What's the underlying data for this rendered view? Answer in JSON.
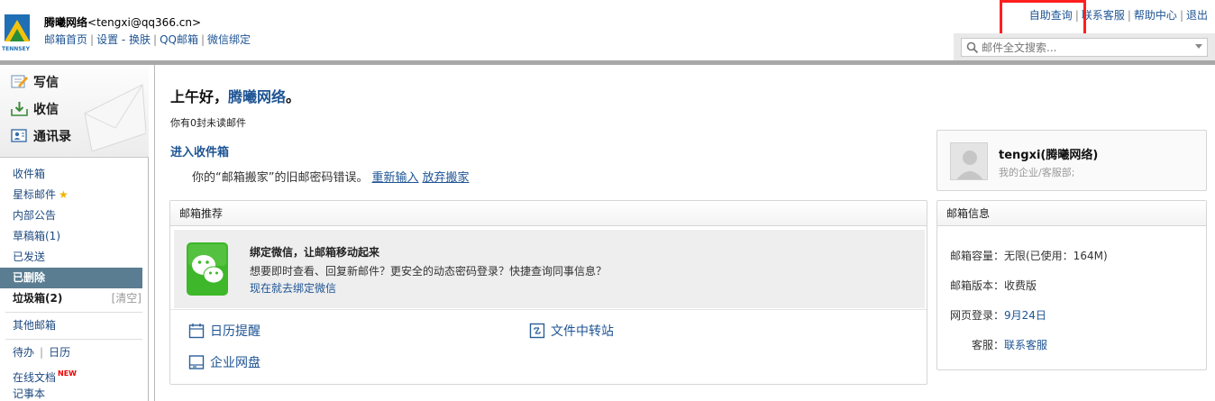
{
  "header": {
    "user_name": "腾曦网络",
    "user_email": "<tengxi@qq366.cn>",
    "nav": [
      "邮箱首页",
      "设置 - 换肤",
      "QQ邮箱",
      "微信绑定"
    ],
    "top_links": [
      "自助查询",
      "联系客服",
      "帮助中心",
      "退出"
    ],
    "search_placeholder": "邮件全文搜索..."
  },
  "sidebar": {
    "compose": "写信",
    "receive": "收信",
    "contacts": "通讯录",
    "folders": [
      {
        "label": "收件箱"
      },
      {
        "label": "星标邮件"
      },
      {
        "label": "内部公告"
      },
      {
        "label": "草稿箱(1)"
      },
      {
        "label": "已发送"
      },
      {
        "label": "已删除"
      },
      {
        "label": "垃圾箱(2)"
      }
    ],
    "clear_label": "[清空]",
    "other_mailbox": "其他邮箱",
    "todo": "待办",
    "calendar": "日历",
    "online_docs": "在线文档",
    "new_badge": "NEW",
    "notes": "记事本"
  },
  "main": {
    "greeting_prefix": "上午好，",
    "greeting_name": "腾曦网络",
    "greeting_suffix": "。",
    "unread": "你有0封未读邮件",
    "enter_inbox": "进入收件箱",
    "move_msg": "你的“邮箱搬家”的旧邮密码错误。",
    "reenter": "重新输入",
    "abandon": "放弃搬家"
  },
  "recommend": {
    "title": "邮箱推荐",
    "wx_title": "绑定微信，让邮箱移动起来",
    "wx_desc": "想要即时查看、回复新邮件？更安全的动态密码登录？快捷查询同事信息？",
    "wx_link": "现在就去绑定微信",
    "quick": [
      "日历提醒",
      "文件中转站",
      "企业网盘"
    ]
  },
  "profile": {
    "name": "tengxi(腾曦网络)",
    "dept": "我的企业/客服部;"
  },
  "mailinfo": {
    "title": "邮箱信息",
    "rows": [
      {
        "k": "邮箱容量：",
        "v": "无限(已使用：164M)"
      },
      {
        "k": "邮箱版本：",
        "v": "收费版"
      },
      {
        "k": "网页登录：",
        "v": "9月24日"
      },
      {
        "k": "客服：",
        "v": "联系客服"
      }
    ]
  },
  "colors": {
    "link": "#1e5494",
    "active_folder": "#5a7d92",
    "highlight": "#ff1f1f",
    "wechat_green": "#3fb72b"
  },
  "icons": [
    "logo",
    "compose-icon",
    "receive-icon",
    "contacts-icon",
    "search-icon",
    "star-icon",
    "wechat-icon",
    "calendar-icon",
    "transfer-icon",
    "disk-icon",
    "avatar-icon"
  ]
}
